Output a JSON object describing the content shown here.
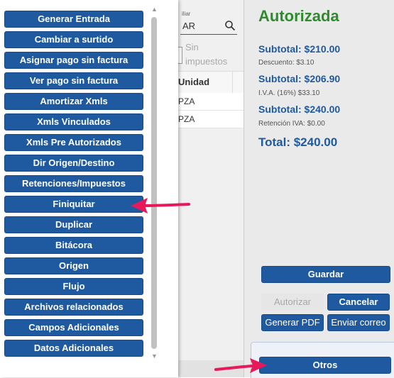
{
  "menu": {
    "items": [
      {
        "label": "Generar Entrada"
      },
      {
        "label": "Cambiar a surtido"
      },
      {
        "label": "Asignar pago sin factura"
      },
      {
        "label": "Ver pago sin factura"
      },
      {
        "label": "Amortizar Xmls"
      },
      {
        "label": "Xmls Vinculados"
      },
      {
        "label": "Xmls Pre Autorizados"
      },
      {
        "label": "Dir Origen/Destino"
      },
      {
        "label": "Retenciones/Impuestos"
      },
      {
        "label": "Finiquitar"
      },
      {
        "label": "Duplicar"
      },
      {
        "label": "Bitácora"
      },
      {
        "label": "Origen"
      },
      {
        "label": "Flujo"
      },
      {
        "label": "Archivos relacionados"
      },
      {
        "label": "Campos Adicionales"
      },
      {
        "label": "Datos Adicionales"
      }
    ]
  },
  "table": {
    "search_label": "iliar",
    "search_value": "AR",
    "tax_option": "Sin impuestos",
    "column_unit": "Unidad",
    "rows": [
      {
        "unit": "PZA"
      },
      {
        "unit": "PZA"
      }
    ]
  },
  "summary": {
    "status": "Autorizada",
    "subtotal_1": "Subtotal: $210.00",
    "descuento": "Descuento: $3.10",
    "subtotal_2": "Subtotal: $206.90",
    "iva": "I.V.A. (16%) $33.10",
    "subtotal_3": "Subtotal: $240.00",
    "retencion": "Retención IVA: $0.00",
    "total": "Total: $240.00"
  },
  "actions": {
    "guardar": "Guardar",
    "autorizar": "Autorizar",
    "cancelar": "Cancelar",
    "generar_pdf": "Generar PDF",
    "enviar_correo": "Enviar correo",
    "otros": "Otros"
  },
  "colors": {
    "primary_button": "#1f5aa0",
    "status_green": "#2e8b2e",
    "annotation_arrow": "#e8195a"
  },
  "icons": {
    "search": "magnifier"
  }
}
